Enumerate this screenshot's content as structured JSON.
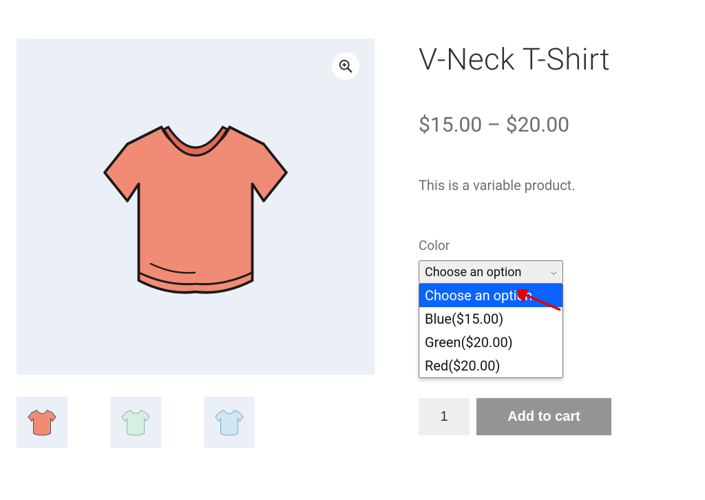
{
  "product": {
    "title": "V-Neck T-Shirt",
    "price_range": "$15.00 – $20.00",
    "description": "This is a variable product."
  },
  "gallery": {
    "thumbs": [
      {
        "color": "red"
      },
      {
        "color": "green"
      },
      {
        "color": "blue"
      }
    ]
  },
  "variation": {
    "label": "Color",
    "selected": "Choose an option",
    "options": [
      {
        "label": "Choose an option",
        "highlighted": true
      },
      {
        "label": "Blue($15.00)"
      },
      {
        "label": "Green($20.00)"
      },
      {
        "label": "Red($20.00)"
      }
    ]
  },
  "cart": {
    "quantity": "1",
    "add_label": "Add to cart"
  }
}
